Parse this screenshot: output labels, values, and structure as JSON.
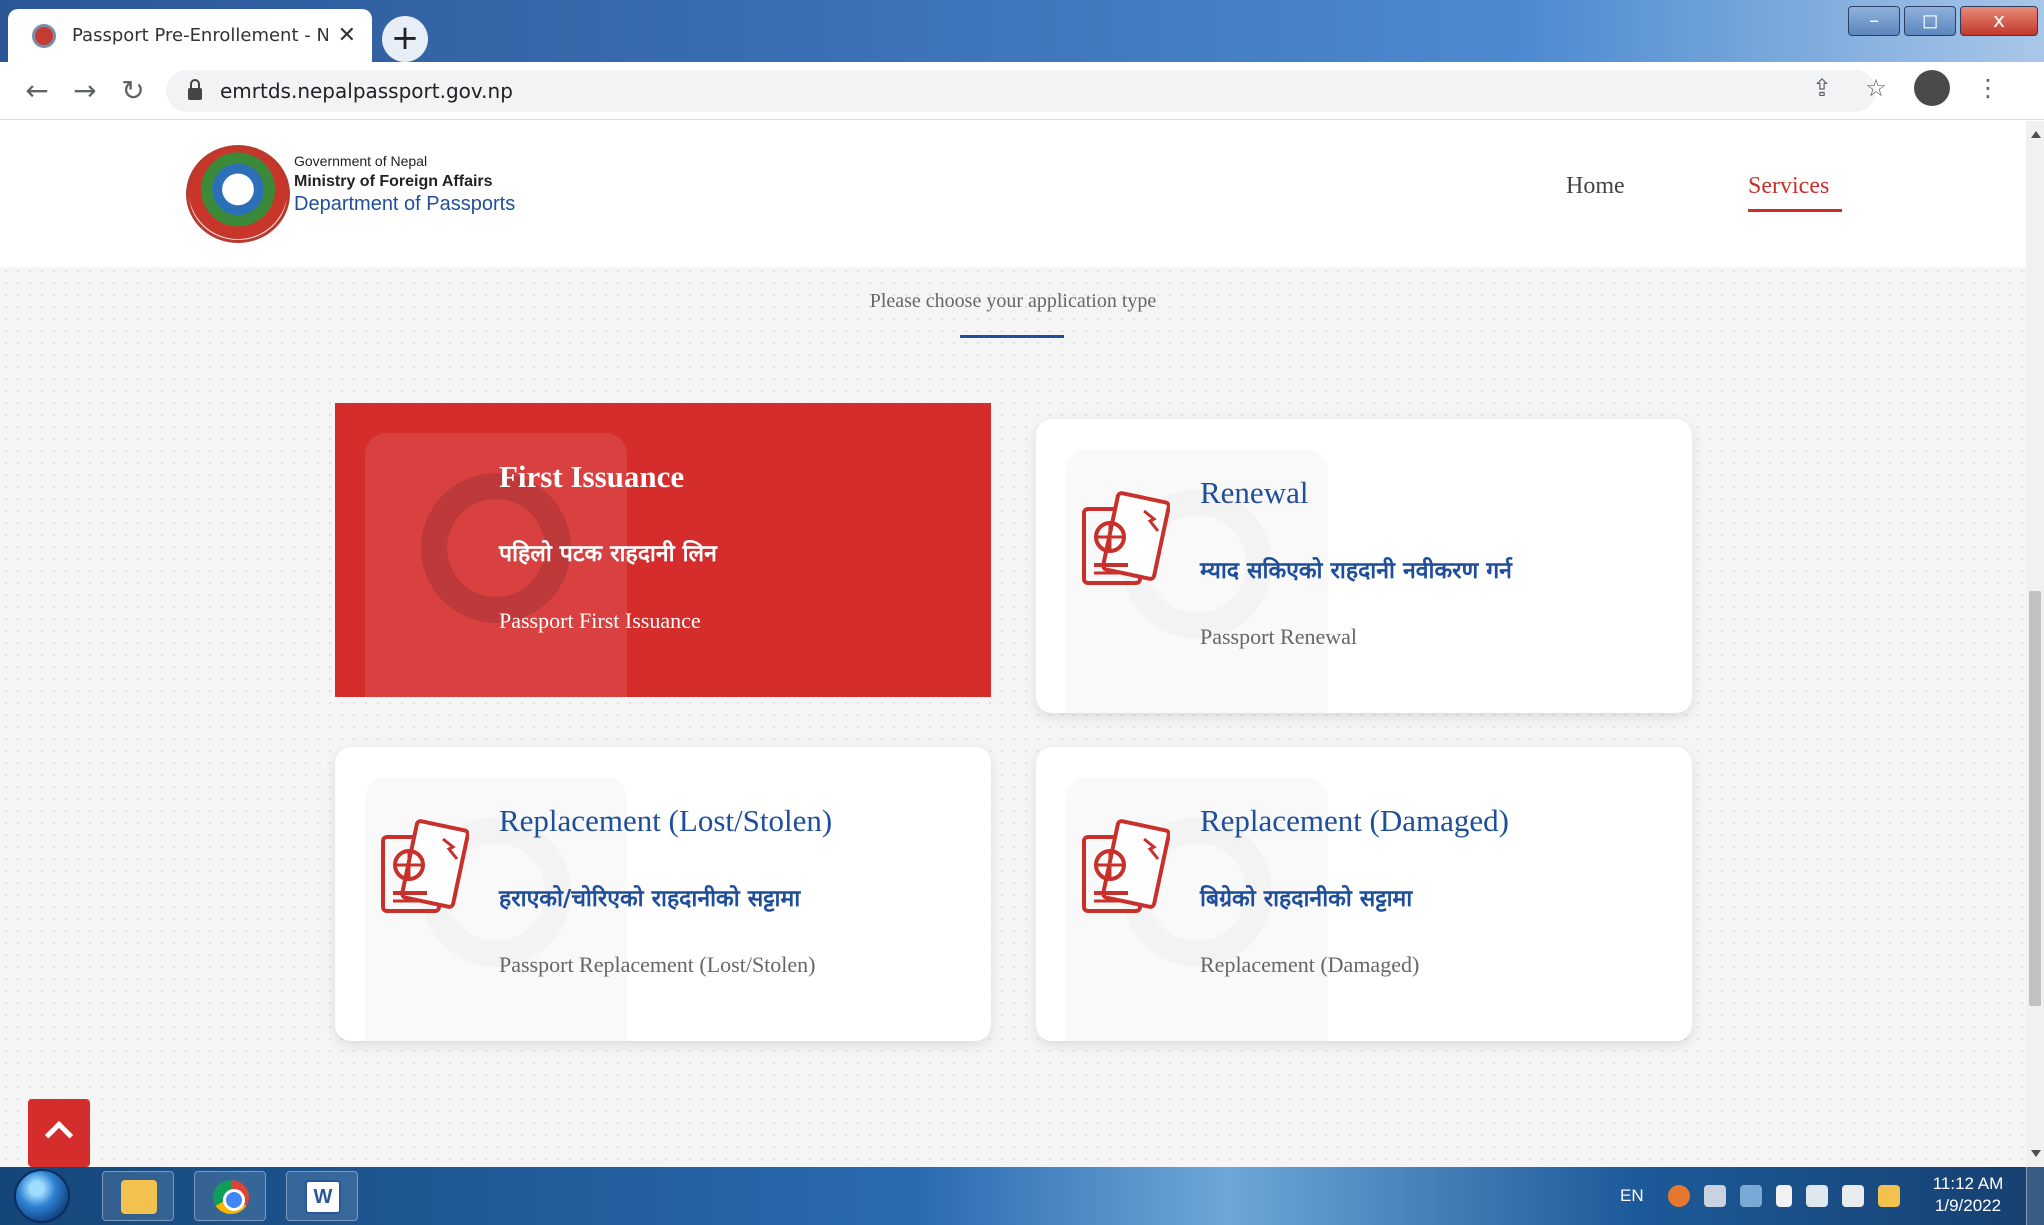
{
  "browser": {
    "tab_title": "Passport Pre-Enrollement - NEPA",
    "tab_close": "✕",
    "new_tab": "+",
    "window_controls": {
      "minimize": "–",
      "maximize": "◻",
      "close": "x"
    },
    "url": "emrtds.nepalpassport.gov.np",
    "icons": [
      "back-arrow-icon",
      "forward-arrow-icon",
      "reload-icon",
      "lock-icon",
      "share-icon",
      "star-icon",
      "profile-avatar",
      "kebab-menu-icon"
    ]
  },
  "site": {
    "brand": {
      "government": "Government of Nepal",
      "ministry": "Ministry of Foreign Affairs",
      "department": "Department of Passports"
    },
    "nav": {
      "home": "Home",
      "services": "Services",
      "active": "Services"
    },
    "subtitle": "Please choose your application type",
    "colors": {
      "primary_blue": "#1f4e9a",
      "accent_red": "#d52c2c"
    },
    "cards": [
      {
        "title": "First Issuance",
        "nepali": "पहिलो पटक राहदानी लिन",
        "desc": "Passport First Issuance",
        "active": true
      },
      {
        "title": "Renewal",
        "nepali": "म्याद सकिएको राहदानी नवीकरण गर्न",
        "desc": "Passport Renewal",
        "active": false
      },
      {
        "title": "Replacement (Lost/Stolen)",
        "nepali": "हराएको/चोरिएको राहदानीको सट्टामा",
        "desc": "Passport Replacement (Lost/Stolen)",
        "active": false
      },
      {
        "title": "Replacement (Damaged)",
        "nepali": "बिग्रेको राहदानीको सट्टामा",
        "desc": "Replacement (Damaged)",
        "active": false
      }
    ]
  },
  "taskbar": {
    "language": "EN",
    "time": "11:12 AM",
    "date": "1/9/2022"
  }
}
